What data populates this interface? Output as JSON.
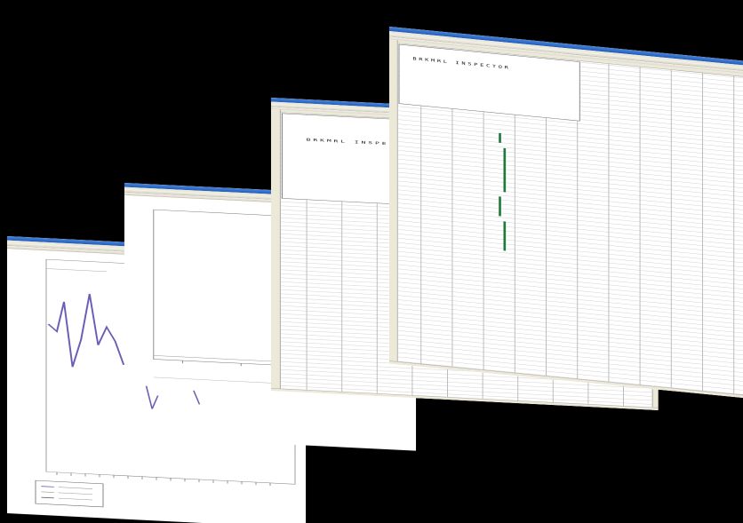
{
  "scene": {
    "background": "#000000",
    "accent": "#2463c6",
    "marker_color": "#1e7a3a",
    "line_color": "#6b5fb5"
  },
  "windows": [
    {
      "kind": "line-chart-window"
    },
    {
      "kind": "spectrum-chart-window"
    },
    {
      "kind": "spreadsheet-form-window"
    },
    {
      "kind": "spreadsheet-form-window"
    }
  ],
  "forms": [
    {
      "title": "BRKMRL INSPECTOR"
    },
    {
      "title": "BRKMRL INSPECTOR"
    }
  ],
  "icons": [
    "window-title-icon",
    "toolbar-icon"
  ]
}
